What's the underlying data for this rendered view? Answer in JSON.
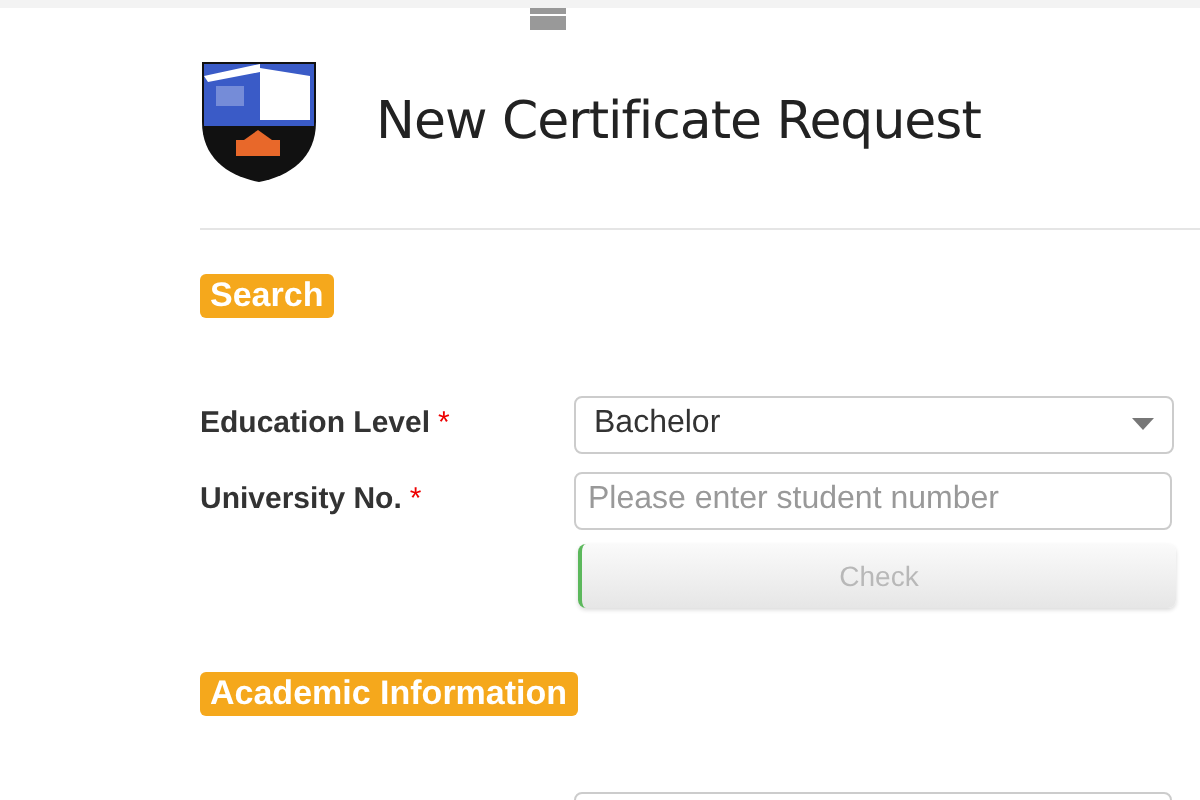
{
  "header": {
    "title": "New Certificate Request"
  },
  "sections": [
    {
      "heading": "Search",
      "fields": [
        {
          "kind": "select",
          "label": "Education Level",
          "required_mark": "*",
          "value": "Bachelor"
        },
        {
          "kind": "input",
          "label": "University No.",
          "required_mark": "*",
          "placeholder": "Please enter student number"
        }
      ],
      "button": {
        "label": "Check",
        "disabled": true
      }
    },
    {
      "heading": "Academic Information",
      "fields": [
        {
          "kind": "input"
        }
      ]
    }
  ]
}
